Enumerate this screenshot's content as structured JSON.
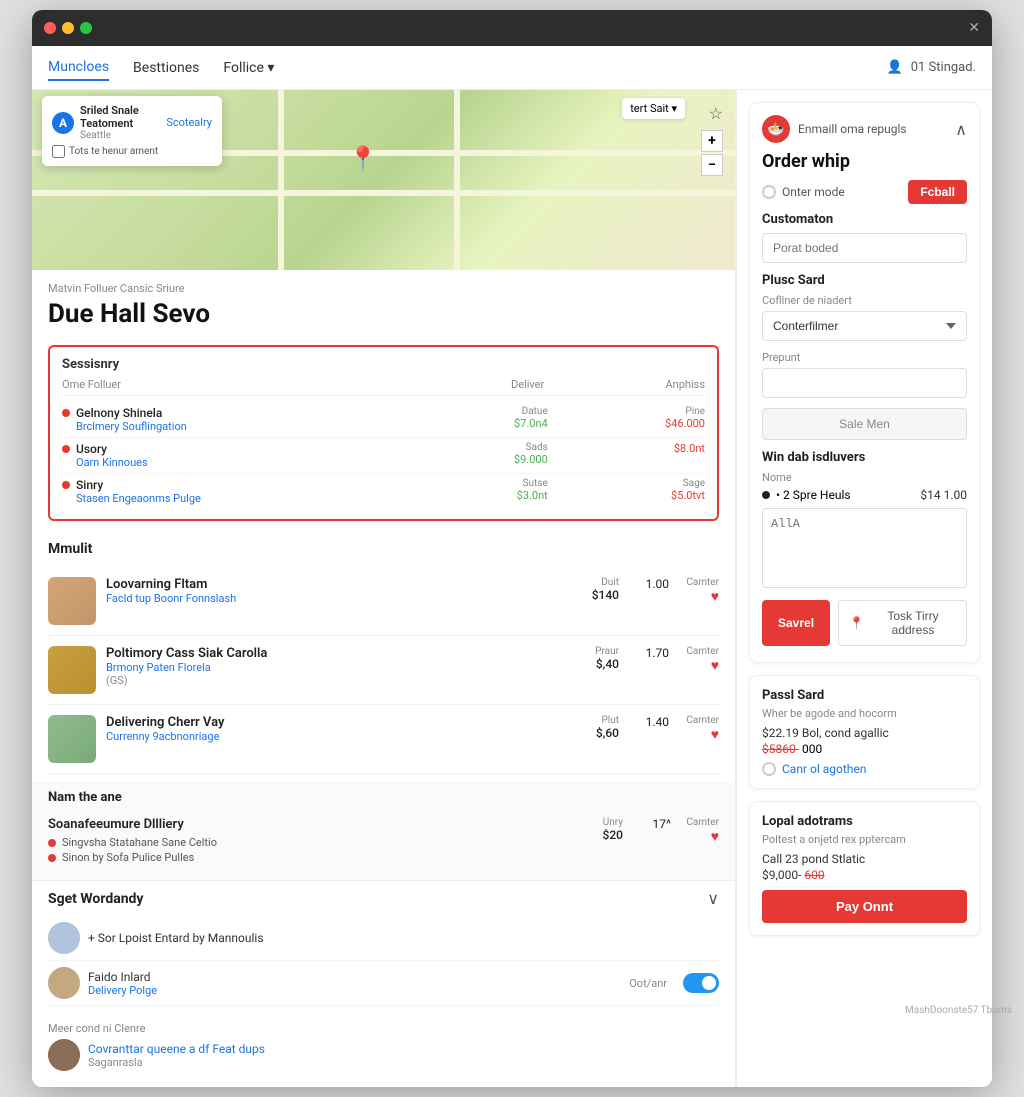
{
  "titlebar": {
    "close_label": "✕"
  },
  "navbar": {
    "items": [
      {
        "label": "Muncloes",
        "active": true
      },
      {
        "label": "Besttiones",
        "active": false
      },
      {
        "label": "Follice ▾",
        "active": false
      }
    ],
    "right_text": "01 Stingad."
  },
  "map": {
    "search_placeholder": "tert Sait ▾",
    "popup": {
      "icon_letter": "A",
      "title": "Sriled Snale Teatoment",
      "subtitle": "Seattle",
      "specialty_label": "Scotealry",
      "checkbox_label": "Tots te henur ament"
    },
    "controls": [
      "+",
      "-"
    ]
  },
  "restaurant": {
    "meta": "Matvin Folluer Cansic Sriure",
    "name": "Due Hall Sevo"
  },
  "sessions": {
    "title": "Sessisnry",
    "header": {
      "name": "Ome Folluer",
      "deliver": "Deliver",
      "anphiss": "Anphiss"
    },
    "rows": [
      {
        "name": "Gelnony Shinela",
        "sub": "Brclmery Souflingation",
        "deliver_label": "Datue",
        "deliver_val": "$7.0n4",
        "price_label": "Pine",
        "price_val": "$46.000"
      },
      {
        "name": "Usory",
        "sub": "Oarn Kinnoues",
        "deliver_label": "Sads",
        "deliver_val": "$9.000",
        "price_label": "",
        "price_val": "$8.0nt"
      },
      {
        "name": "Sinry",
        "sub": "Stasen Engeaonms Pulge",
        "deliver_label": "Sutse",
        "deliver_val": "$3.0nt",
        "price_label": "Sage",
        "price_val": "$5.0tvt"
      }
    ]
  },
  "menu": {
    "title": "Mmulit",
    "items": [
      {
        "name": "Loovarning Fltam",
        "sub": "Facld tup Boonr Fonnslash",
        "desc": "",
        "price_label": "Duit",
        "price_val": "$140",
        "qty_label": "",
        "qty_val": "1.00",
        "cart_label": "Camter"
      },
      {
        "name": "Poltimory Cass Siak Carolla",
        "sub": "Brmony Paten Florela",
        "desc": "(GS)",
        "price_label": "Praur",
        "price_val": "$,40",
        "qty_label": "",
        "qty_val": "1.70",
        "cart_label": "Camter"
      },
      {
        "name": "Delivering Cherr Vay",
        "sub": "Currenny 9acbnonriage",
        "desc": "",
        "price_label": "Plut",
        "price_val": "$,60",
        "qty_label": "",
        "qty_val": "1.40",
        "cart_label": "Camter"
      }
    ]
  },
  "delivery_section": {
    "title": "Nam the ane",
    "service_name": "Soanafeeumure Dllliery",
    "items": [
      {
        "text": "Singvsha Statahane Sane Celtio"
      },
      {
        "text": "Sinon by Sofa Pulice Pulles"
      }
    ],
    "price_label": "Unry",
    "price_val": "$20",
    "qty_val": "17^",
    "cart_label": "Camter"
  },
  "sget_section": {
    "title": "Sget Wordandy",
    "items": [
      {
        "name": "+ Sor Lpoist Entard by Mannoulis",
        "has_toggle": false
      },
      {
        "name": "Faido Inlard",
        "sub": "Delivery Polge",
        "col": "Oot/anr",
        "has_toggle": true
      }
    ]
  },
  "more_section": {
    "label": "Meer cond ni Clenre",
    "link": "Covranttar queene a df Feat dups",
    "sub": "Saganrasla"
  },
  "right_panel": {
    "order_section": {
      "header_title": "Enmaill oma repugls",
      "order_title": "Order whip",
      "order_mode_label": "Onter mode",
      "order_mode_btn": "Fcball",
      "customation_label": "Customaton",
      "customation_placeholder": "Porat boded",
      "plusc_sard_label": "Plusc Sard",
      "cofftner_label": "Cofllner de niadert",
      "cofftner_placeholder": "Conterfilmer",
      "prepunt_label": "Prepunt",
      "prepunt_placeholder": "",
      "sale_men_btn": "Sale Men",
      "win_dab_title": "Win dab isdluvers",
      "name_label": "Nome",
      "item_name": "• 2 Spre Heuls",
      "item_price": "$14 1.00",
      "textarea_placeholder": "AllA",
      "save_btn": "Savrel",
      "test_addr_btn": "Tosk Tirry address"
    },
    "past_sard": {
      "title": "Passl Sard",
      "desc": "Wher be agode and hocorm",
      "price": "$22.19 Bol, cond agallic",
      "disc_original": "$5860-",
      "disc_val": "000",
      "radio_label": "Canr ol agothen"
    },
    "lopal": {
      "title": "Lopal adotrams",
      "desc": "Poltest a onjetd rex pptercam",
      "address": "Call 23 pond Stlatic",
      "price": "$9,000-",
      "disc": "600",
      "pay_btn": "Pay Onnt"
    }
  },
  "watermark": "MashDoonste57 Tborns"
}
